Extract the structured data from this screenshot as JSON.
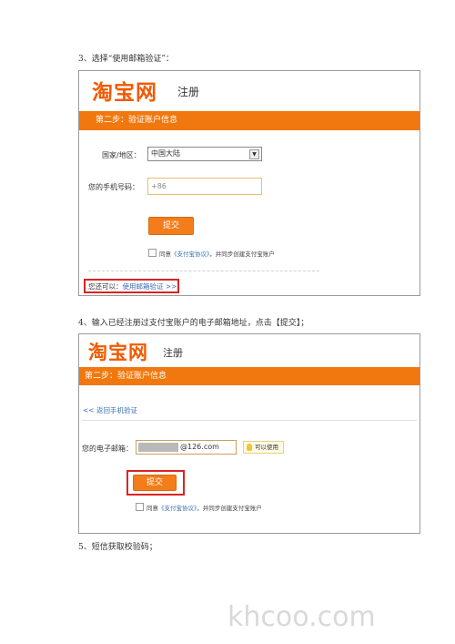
{
  "steps": {
    "step3": "3、选择“使用邮箱验证”：",
    "step4": "4、输入已经注册过支付宝账户的电子邮箱地址，点击【提交】；",
    "step5": "5、短信获取校验码；"
  },
  "screen1": {
    "logo": "淘宝网",
    "logo_sub": "注册",
    "bar_title": "第二步：验证账户信息",
    "country_label": "国家/地区：",
    "country_value": "中国大陆",
    "phone_label": "您的手机号码：",
    "phone_placeholder": "+86",
    "submit_label": "提交",
    "agree_prefix": "同意",
    "agree_link": "《支付宝协议》",
    "agree_suffix": "，并同步创建支付宝账户",
    "alt_prefix": "您还可以：",
    "alt_link": "使用邮箱验证",
    "alt_arrow": ">>"
  },
  "screen2": {
    "logo": "淘宝网",
    "logo_sub": "注册",
    "bar_title": "第二步：验证账户信息",
    "back_arrow": "<<",
    "back_link": "返回手机验证",
    "email_label": "您的电子邮箱：",
    "email_suffix": "@126.com",
    "hint_text": "可以使用",
    "submit_label": "提交",
    "agree_prefix": "同意",
    "agree_link": "《支付宝协议》",
    "agree_suffix": "，并同步创建支付宝账户"
  },
  "watermark": "khcoo.com",
  "colors": {
    "brand_orange": "#f15a00",
    "bar_orange": "#f0780e",
    "highlight_red": "#dd2222",
    "link_blue": "#3a6fb0"
  },
  "icons": {
    "dropdown": "chevron-down-icon",
    "hint": "lightbulb-icon",
    "back": "double-left-arrow-icon",
    "forward": "double-right-arrow-icon"
  }
}
